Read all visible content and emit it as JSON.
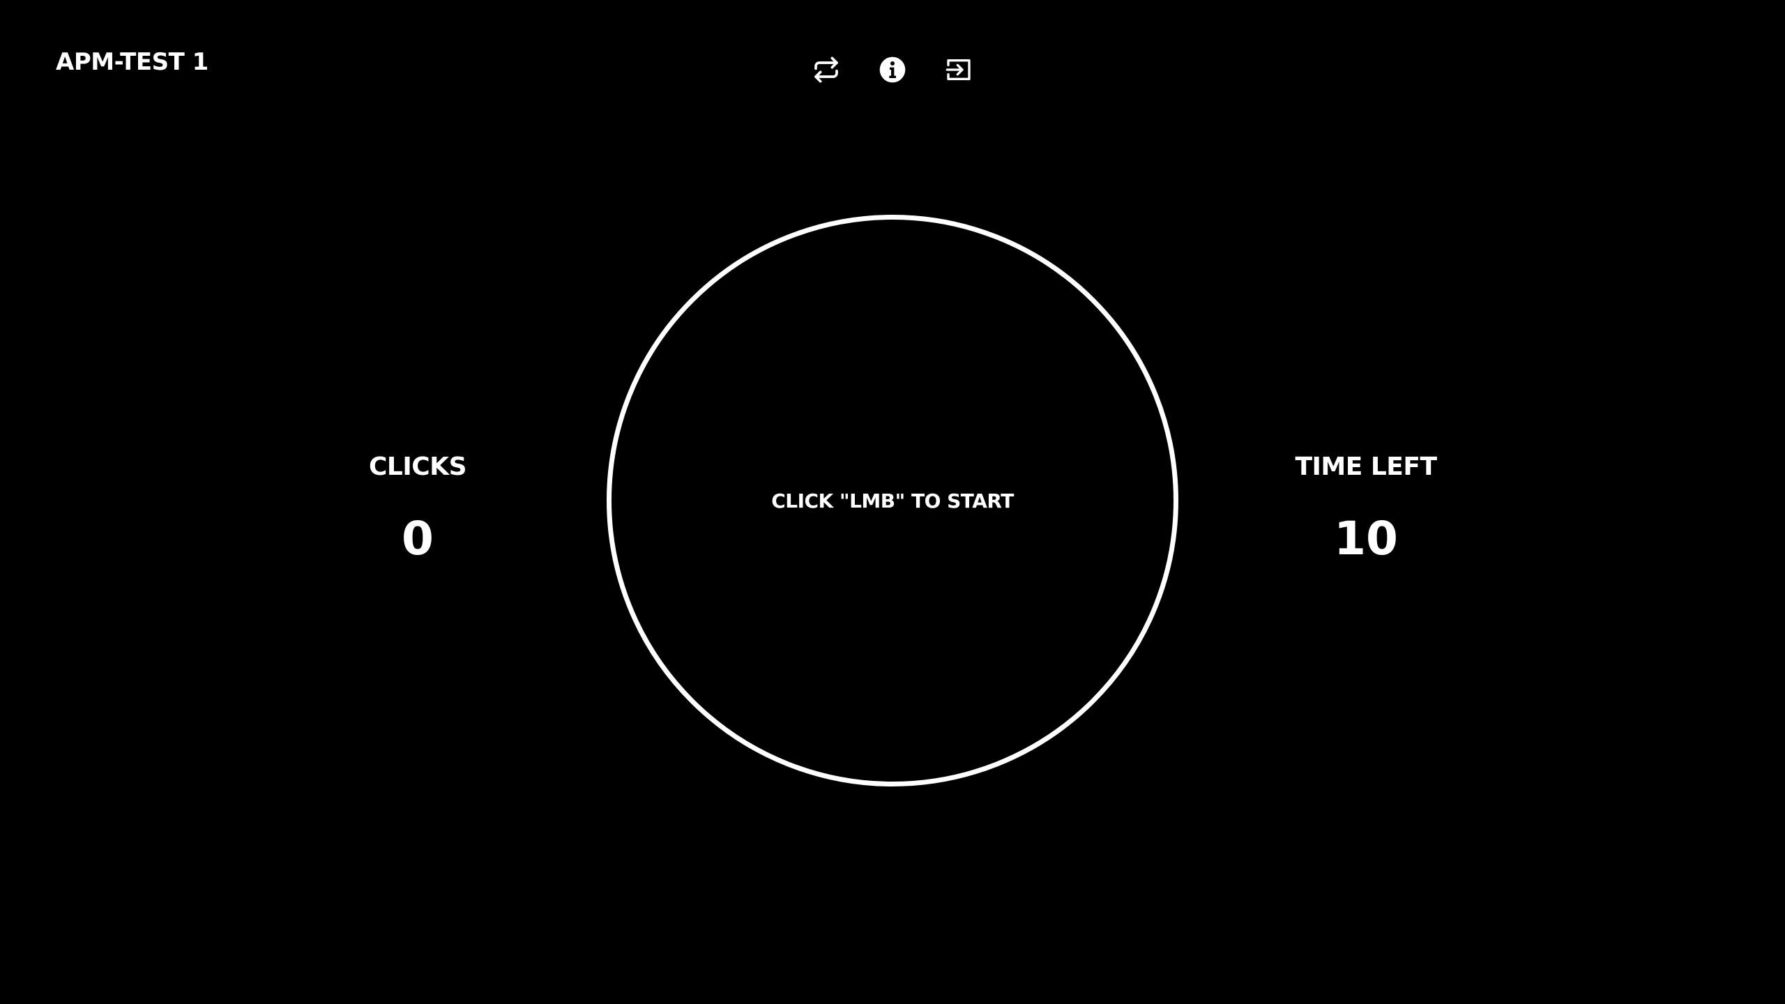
{
  "app": {
    "title": "APM-TEST 1"
  },
  "toolbar": {
    "buttons": [
      {
        "icon": "repeat-icon"
      },
      {
        "icon": "info-icon"
      },
      {
        "icon": "exit-icon"
      }
    ]
  },
  "stats": {
    "clicks": {
      "label": "CLICKS",
      "value": "0"
    },
    "time_left": {
      "label": "TIME LEFT",
      "value": "10"
    }
  },
  "click_area": {
    "prompt": "CLICK \"LMB\" TO START"
  },
  "colors": {
    "background": "#000000",
    "foreground": "#ffffff"
  }
}
